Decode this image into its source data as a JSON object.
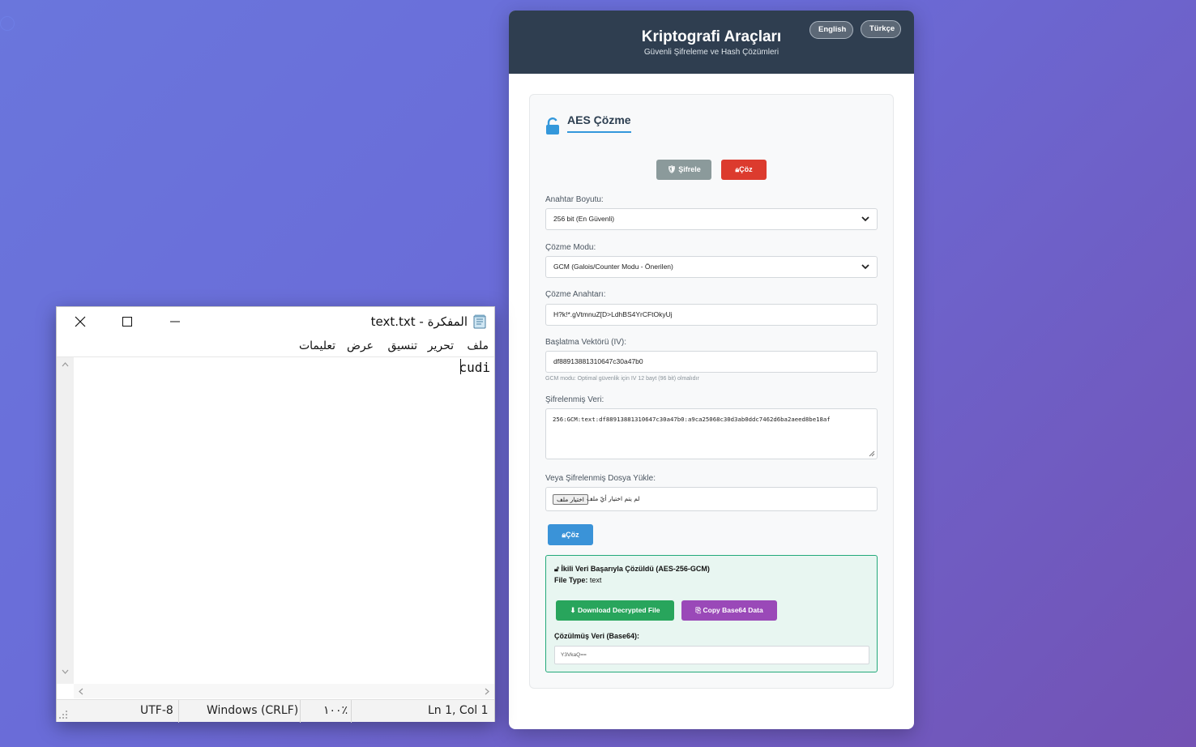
{
  "app": {
    "title": "Kriptografi Araçları",
    "subtitle": "Güvenli Şifreleme ve Hash Çözümleri",
    "lang_en": "English",
    "lang_tr": "Türkçe",
    "section_title": "AES Çözme",
    "btn_encrypt": "Şifrele",
    "btn_decrypt": "Çöz",
    "key_size_label": "Anahtar Boyutu:",
    "key_size_value": "256 bit (En Güvenli)",
    "mode_label": "Çözme Modu:",
    "mode_value": "GCM (Galois/Counter Modu - Önerilen)",
    "key_label": "Çözme Anahtarı:",
    "key_value": "H?k!*.gVtmnuZ[D>LdhBS4YrCFtOkyUj",
    "iv_label": "Başlatma Vektörü (IV):",
    "iv_value": "df88913881310647c30a47b0",
    "iv_hint": "GCM modu: Optimal güvenlik için IV 12 bayt (96 bit) olmalıdır",
    "cipher_label": "Şifrelenmiş Veri:",
    "cipher_value": "256:GCM:text:df88913881310647c30a47b0:a9ca25068c30d3ab0ddc7462d6ba2aeed8be18af",
    "file_label": "Veya Şifrelenmiş Dosya Yükle:",
    "file_button": "اختيار ملف",
    "file_none": "لم يتم اختيار أيّ ملف",
    "submit": "Çöz",
    "result_title": "İkili Veri Başarıyla Çözüldü (AES-256-GCM)",
    "file_type_key": "File Type:",
    "file_type_value": "text",
    "btn_download": "Download Decrypted File",
    "btn_copy": "Copy Base64 Data",
    "output_label": "Çözülmüş Veri (Base64):",
    "output_value": "Y3VkaQ=="
  },
  "notepad": {
    "title": "text.txt - المفكرة",
    "menu": {
      "file": "ملف",
      "edit": "تحرير",
      "format": "تنسيق",
      "view": "عرض",
      "help": "تعليمات"
    },
    "content": "cudi",
    "status": {
      "position": "Ln 1, Col 1",
      "zoom": "١٠٠٪",
      "line_ending": "Windows (CRLF)",
      "encoding": "UTF-8"
    }
  },
  "colors": {
    "header": "#2f3e50",
    "accent": "#3498db",
    "danger": "#dc3b2e",
    "success": "#28a55c",
    "purple": "#9a49b8"
  }
}
